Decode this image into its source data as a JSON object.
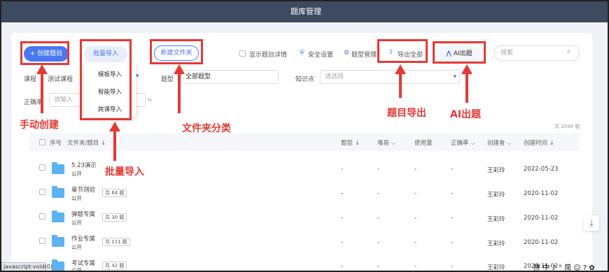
{
  "title": "题库管理",
  "toolbar": {
    "create": "+ 创建题目",
    "batch": "批量导入",
    "new_folder": "新建文件夹",
    "show_detail": "显示题目详情",
    "security": "安全设置",
    "question_mgmt": "题型管理",
    "export_all": "导出全部",
    "ai": "AI出题",
    "search_placeholder": "搜索"
  },
  "dropdown": [
    "模板导入",
    "智能导入",
    "跨课导入"
  ],
  "filters": {
    "course_label": "课程",
    "course_value": "测试课程",
    "type_label": "题型",
    "type_value": "全部题型",
    "knowledge_label": "知识点",
    "knowledge_placeholder": "请选择",
    "accuracy_label": "正确率",
    "accuracy_placeholder": "请输入",
    "percent": "%"
  },
  "total": "共 2048 题",
  "table": {
    "headers": [
      "序号",
      "文件夹/题目",
      "题型",
      "难易",
      "使用量",
      "正确率",
      "创建者",
      "创建时间"
    ],
    "rows": [
      {
        "name": "5.23演示",
        "sub": "公开",
        "badge": "",
        "type": "-",
        "diff": "-",
        "usage": "-",
        "rate": "-",
        "creator": "王彩玲",
        "date": "2022-05-23"
      },
      {
        "name": "章节测验",
        "sub": "公开",
        "badge": "共 64 题",
        "type": "-",
        "diff": "-",
        "usage": "-",
        "rate": "-",
        "creator": "王彩玲",
        "date": "2020-11-02"
      },
      {
        "name": "弹题专属",
        "sub": "公开",
        "badge": "共 30 题",
        "type": "-",
        "diff": "-",
        "usage": "-",
        "rate": "-",
        "creator": "王彩玲",
        "date": "2020-11-02"
      },
      {
        "name": "作业专属",
        "sub": "公开",
        "badge": "共 111 题",
        "type": "-",
        "diff": "-",
        "usage": "-",
        "rate": "-",
        "creator": "王彩玲",
        "date": "2020-11-02"
      },
      {
        "name": "考试专属",
        "sub": "公开",
        "badge": "共 42 题",
        "type": "-",
        "diff": "-",
        "usage": "-",
        "rate": "-",
        "creator": "王彩玲",
        "date": "2020-11-02"
      }
    ]
  },
  "annotations": {
    "manual": "手动创建",
    "batch": "批量导入",
    "folder": "文件夹分类",
    "export": "题目导出",
    "ai": "AI出题"
  },
  "statusbar": "javascript:void(0)",
  "ime": "拼 中 ♪ ° 简 ☺ ? ✿"
}
